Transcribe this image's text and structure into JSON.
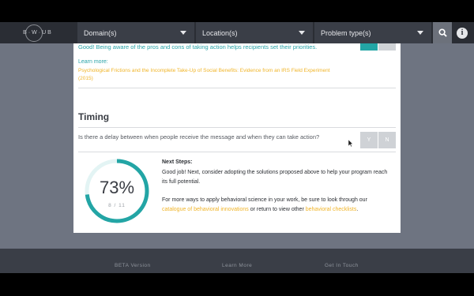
{
  "header": {
    "logo_text": "B·W·UB",
    "dropdowns": [
      {
        "label": "Domain(s)"
      },
      {
        "label": "Location(s)"
      },
      {
        "label": "Problem type(s)"
      }
    ],
    "search_icon": "search-icon",
    "info_icon": "info-icon",
    "info_glyph": "i"
  },
  "previous_question": {
    "feedback": "Good! Being aware of the pros and cons of taking action helps recipients set their priorities.",
    "learn_more_label": "Learn more:",
    "learn_more_link": "Psychological Frictions and the Incomplete Take-Up of Social Benefits: Evidence from an IRS Field Experiment (2015)"
  },
  "section": {
    "title": "Timing",
    "question": "Is there a delay between when people receive the message and when they can take action?",
    "yes_label": "Y",
    "no_label": "N"
  },
  "progress": {
    "percent_label": "73%",
    "count_label": "8 / 11",
    "fraction": 0.73,
    "accent_color": "#23a5a5",
    "track_color": "#e3f4f4"
  },
  "next_steps": {
    "title": "Next Steps:",
    "body": "Good job! Next, consider adopting the solutions proposed above to help your program reach its full potential.",
    "more_prefix": "For more ways to apply behavioral science in your work, be sure to look through our ",
    "catalogue_link": "catalogue of behavioral innovations",
    "more_middle": " or return to view other ",
    "checklists_link": "behavioral checklists",
    "more_suffix": "."
  },
  "footer": {
    "beta": "BETA Version",
    "learn_more": "Learn More",
    "get_in_touch": "Get In Touch"
  }
}
